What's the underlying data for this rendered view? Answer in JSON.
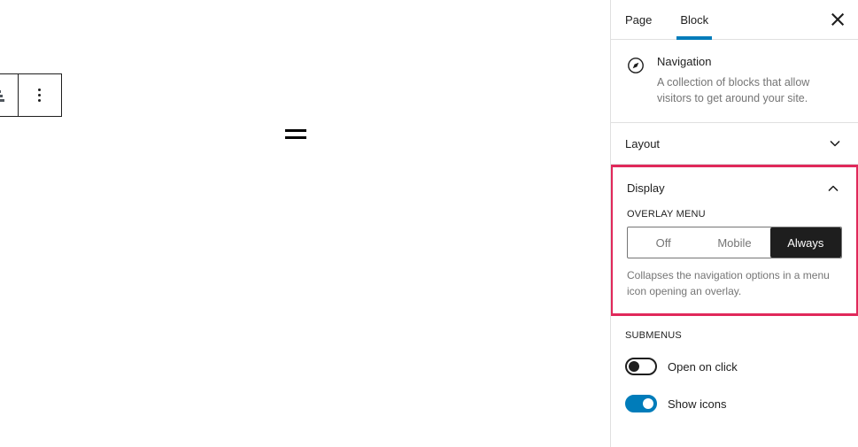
{
  "canvas": {
    "block_toolbar": {
      "align_button_name": "align-text-button",
      "options_button_name": "more-options-button"
    },
    "nav_block_name": "navigation-overlay-menu-icon"
  },
  "sidebar": {
    "tabs": [
      {
        "label": "Page",
        "active": false
      },
      {
        "label": "Block",
        "active": true
      }
    ],
    "close_label": "Close settings",
    "block_card": {
      "title": "Navigation",
      "description": "A collection of blocks that allow visitors to get around your site."
    },
    "panels": [
      {
        "label": "Layout",
        "expanded": false
      },
      {
        "label": "Display",
        "expanded": true
      }
    ],
    "display": {
      "overlay_menu_label": "OVERLAY MENU",
      "options": [
        {
          "label": "Off",
          "selected": false
        },
        {
          "label": "Mobile",
          "selected": false
        },
        {
          "label": "Always",
          "selected": true
        }
      ],
      "help_text": "Collapses the navigation options in a menu icon opening an overlay."
    },
    "submenus": {
      "section_label": "SUBMENUS",
      "toggles": [
        {
          "label": "Open on click",
          "on": false
        },
        {
          "label": "Show icons",
          "on": true
        }
      ]
    }
  },
  "colors": {
    "accent_blue": "#007cba",
    "highlight_pink": "#e0285a",
    "selected_dark": "#1e1e1e",
    "muted_text": "#757575"
  }
}
